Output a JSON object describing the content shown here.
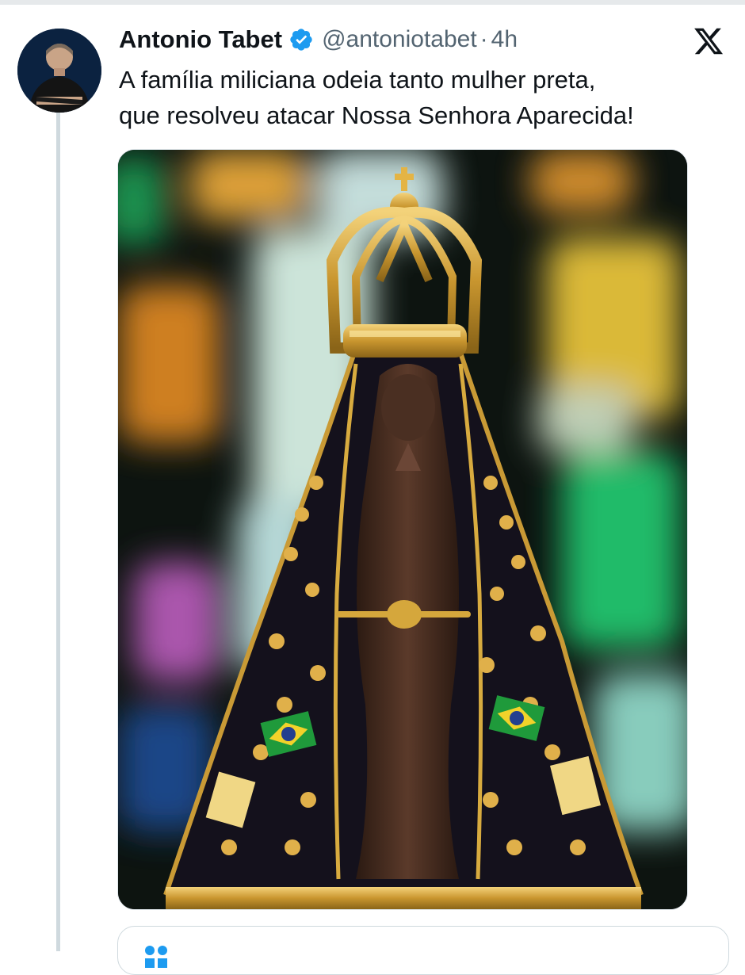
{
  "tweet": {
    "author_name": "Antonio Tabet",
    "handle": "@antoniotabet",
    "separator": "·",
    "time": "4h",
    "text_line1": "A família miliciana odeia tanto mulher preta,",
    "text_line2": "que resolveu atacar Nossa Senhora Aparecida!",
    "verified": true
  },
  "icons": {
    "verified": "verified-badge-icon",
    "platform": "x-logo-icon"
  },
  "quoted": {
    "partial_text": ""
  },
  "colors": {
    "text": "#0f1419",
    "muted": "#536471",
    "verified_blue": "#1d9bf0",
    "thread_line": "#cfd9de"
  }
}
